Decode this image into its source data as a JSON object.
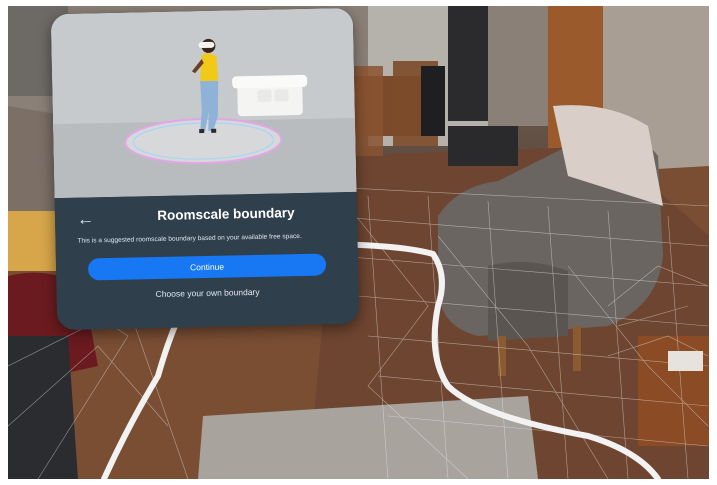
{
  "dialog": {
    "title": "Roomscale boundary",
    "description": "This is a suggested roomscale boundary based on your available free space.",
    "back_icon": "arrow-left-icon",
    "continue_label": "Continue",
    "choose_own_label": "Choose your own boundary"
  },
  "colors": {
    "panel_bg": "#2f3f4c",
    "primary_button": "#1877f2",
    "boundary_line": "#f2f2f2"
  }
}
